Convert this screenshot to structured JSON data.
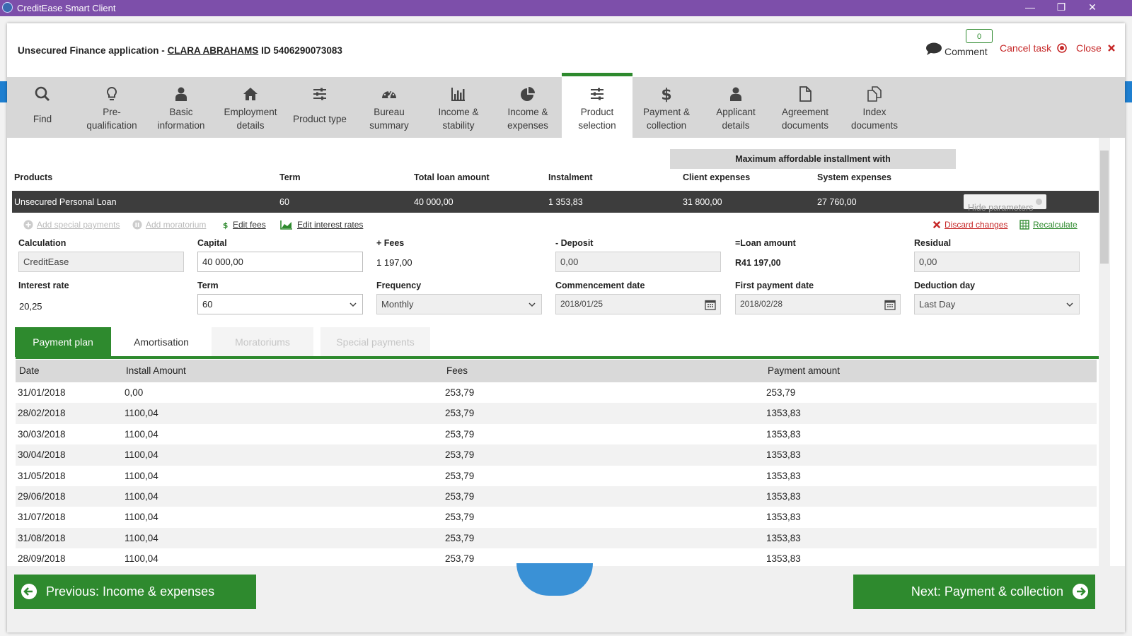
{
  "window": {
    "title": "CreditEase Smart Client",
    "minimize": "—",
    "restore": "❐",
    "close": "✕"
  },
  "header": {
    "application_type": "Unsecured Finance application -",
    "client_name": "CLARA ABRAHAMS",
    "id_label": "ID 5406290073083",
    "comment_count": "0",
    "comment_label": "Comment",
    "cancel_task": "Cancel task",
    "close": "Close"
  },
  "nav": [
    {
      "line1": "Find",
      "line2": "",
      "icon": "search-icon"
    },
    {
      "line1": "Pre-",
      "line2": "qualification",
      "icon": "lightbulb-icon"
    },
    {
      "line1": "Basic",
      "line2": "information",
      "icon": "person-icon"
    },
    {
      "line1": "Employment",
      "line2": "details",
      "icon": "home-icon"
    },
    {
      "line1": "Product type",
      "line2": "",
      "icon": "sliders-icon"
    },
    {
      "line1": "Bureau",
      "line2": "summary",
      "icon": "gauge-icon"
    },
    {
      "line1": "Income &",
      "line2": "stability",
      "icon": "bar-chart-icon"
    },
    {
      "line1": "Income &",
      "line2": "expenses",
      "icon": "pie-chart-icon"
    },
    {
      "line1": "Product",
      "line2": "selection",
      "icon": "sliders-icon",
      "active": true
    },
    {
      "line1": "Payment &",
      "line2": "collection",
      "icon": "dollar-icon"
    },
    {
      "line1": "Applicant",
      "line2": "details",
      "icon": "person-icon"
    },
    {
      "line1": "Agreement",
      "line2": "documents",
      "icon": "document-icon"
    },
    {
      "line1": "Index",
      "line2": "documents",
      "icon": "documents-icon"
    }
  ],
  "products": {
    "max_affordable_header": "Maximum affordable installment with",
    "columns": [
      "Products",
      "Term",
      "Total loan amount",
      "Instalment",
      "Client expenses",
      "System expenses"
    ],
    "row": {
      "product": "Unsecured Personal Loan",
      "term": "60",
      "total_loan_amount": "40 000,00",
      "instalment": "1 353,83",
      "client_expenses": "31 800,00",
      "system_expenses": "27 760,00"
    },
    "hide_parameters": "Hide parameters"
  },
  "actions": {
    "add_special_payments": "Add special payments",
    "add_moratorium": "Add moratorium",
    "edit_fees": "Edit fees",
    "edit_interest_rates": "Edit interest rates",
    "discard_changes": "Discard changes",
    "recalculate": "Recalculate"
  },
  "params": {
    "calculation": {
      "label": "Calculation",
      "value": "CreditEase"
    },
    "capital": {
      "label": "Capital",
      "value": "40 000,00"
    },
    "fees": {
      "label": "+ Fees",
      "value": "1 197,00"
    },
    "deposit": {
      "label": "- Deposit",
      "value": "0,00"
    },
    "loan_amount": {
      "label": "=Loan amount",
      "value": "R41 197,00"
    },
    "residual": {
      "label": "Residual",
      "value": "0,00"
    },
    "interest_rate": {
      "label": "Interest rate",
      "value": "20,25"
    },
    "term": {
      "label": "Term",
      "value": "60"
    },
    "frequency": {
      "label": "Frequency",
      "value": "Monthly"
    },
    "commencement_date": {
      "label": "Commencement date",
      "value": "2018/01/25"
    },
    "first_payment_date": {
      "label": "First payment date",
      "value": "2018/02/28"
    },
    "deduction_day": {
      "label": "Deduction day",
      "value": "Last Day"
    }
  },
  "tabs": [
    "Payment plan",
    "Amortisation",
    "Moratoriums",
    "Special payments"
  ],
  "payment_plan": {
    "columns": [
      "Date",
      "Install Amount",
      "Fees",
      "Payment amount"
    ],
    "rows": [
      [
        "31/01/2018",
        "0,00",
        "253,79",
        "253,79"
      ],
      [
        "28/02/2018",
        "1100,04",
        "253,79",
        "1353,83"
      ],
      [
        "30/03/2018",
        "1100,04",
        "253,79",
        "1353,83"
      ],
      [
        "30/04/2018",
        "1100,04",
        "253,79",
        "1353,83"
      ],
      [
        "31/05/2018",
        "1100,04",
        "253,79",
        "1353,83"
      ],
      [
        "29/06/2018",
        "1100,04",
        "253,79",
        "1353,83"
      ],
      [
        "31/07/2018",
        "1100,04",
        "253,79",
        "1353,83"
      ],
      [
        "31/08/2018",
        "1100,04",
        "253,79",
        "1353,83"
      ],
      [
        "28/09/2018",
        "1100,04",
        "253,79",
        "1353,83"
      ]
    ]
  },
  "footer": {
    "previous": "Previous: Income & expenses",
    "next": "Next: Payment & collection"
  },
  "colors": {
    "accent": "#2e8a2e",
    "titlebar": "#7d4faa",
    "danger": "#c62828",
    "nav_bg": "#d7d7d7"
  }
}
